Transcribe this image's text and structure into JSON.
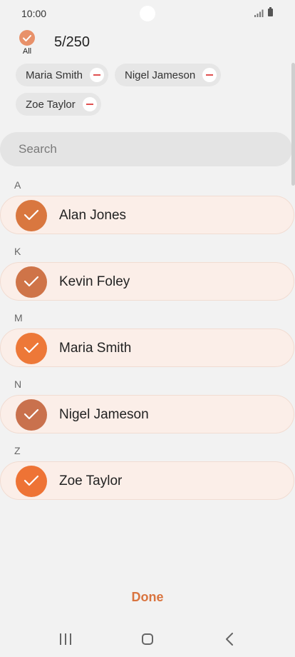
{
  "status_bar": {
    "time": "10:00"
  },
  "header": {
    "select_all_label": "All",
    "count": "5/250"
  },
  "chips": [
    {
      "label": "Maria Smith"
    },
    {
      "label": "Nigel Jameson"
    },
    {
      "label": "Zoe Taylor"
    }
  ],
  "search": {
    "placeholder": "Search"
  },
  "sections": [
    {
      "letter": "A",
      "contact": "Alan Jones",
      "avatar_color": "#d9773f"
    },
    {
      "letter": "K",
      "contact": "Kevin Foley",
      "avatar_color": "#cf7448"
    },
    {
      "letter": "M",
      "contact": "Maria Smith",
      "avatar_color": "#ed7838"
    },
    {
      "letter": "N",
      "contact": "Nigel Jameson",
      "avatar_color": "#c9714d"
    },
    {
      "letter": "Z",
      "contact": "Zoe Taylor",
      "avatar_color": "#ee7335"
    }
  ],
  "footer": {
    "done_label": "Done"
  },
  "colors": {
    "accent": "#d9743f",
    "row_background": "#fbeee8",
    "remove_icon": "#e05050"
  },
  "icons": {
    "select_all": "check-circle-icon",
    "chip_remove": "minus-circle-icon",
    "avatar_check": "check-icon",
    "nav": [
      "recents-icon",
      "home-icon",
      "back-icon"
    ]
  }
}
